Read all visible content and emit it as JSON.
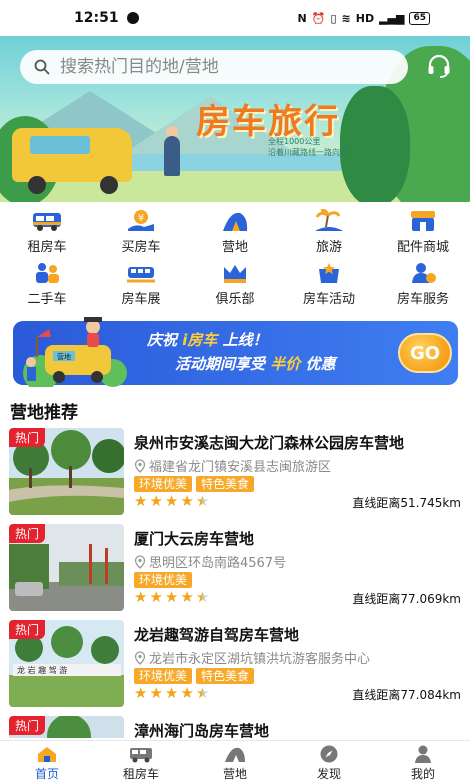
{
  "status_bar": {
    "time": "12:51",
    "battery": "65"
  },
  "hero": {
    "title": "房车旅行",
    "subtitle_1": "全程1000公里",
    "subtitle_2": "沿着川藏路线一路向西"
  },
  "search": {
    "placeholder": "搜索热门目的地/营地"
  },
  "categories": [
    {
      "label": "租房车",
      "icon": "rv-rental-icon"
    },
    {
      "label": "买房车",
      "icon": "buy-rv-icon"
    },
    {
      "label": "营地",
      "icon": "campsite-icon"
    },
    {
      "label": "旅游",
      "icon": "travel-icon"
    },
    {
      "label": "配件商城",
      "icon": "parts-shop-icon"
    },
    {
      "label": "二手车",
      "icon": "used-car-icon"
    },
    {
      "label": "房车展",
      "icon": "rv-expo-icon"
    },
    {
      "label": "俱乐部",
      "icon": "club-icon"
    },
    {
      "label": "房车活动",
      "icon": "rv-events-icon"
    },
    {
      "label": "房车服务",
      "icon": "rv-service-icon"
    }
  ],
  "promo": {
    "line1_prefix": "庆祝",
    "line1_highlight": "i房车",
    "line1_suffix": "上线！",
    "line2_prefix": "活动期间享受",
    "line2_highlight": "半价",
    "line2_suffix": "优惠",
    "go_label": "GO",
    "sign_text": "营地"
  },
  "section_title": "营地推荐",
  "camps": [
    {
      "hot": "热门",
      "name": "泉州市安溪志闽大龙门森林公园房车营地",
      "address": "福建省龙门镇安溪县志闽旅游区",
      "tags": [
        "环境优美",
        "特色美食"
      ],
      "rating": 4.5,
      "distance": "直线距离51.745km"
    },
    {
      "hot": "热门",
      "name": "厦门大云房车营地",
      "address": "思明区环岛南路4567号",
      "tags": [
        "环境优美"
      ],
      "rating": 4.5,
      "distance": "直线距离77.069km"
    },
    {
      "hot": "热门",
      "name": "龙岩趣驾游自驾房车营地",
      "address": "龙岩市永定区湖坑镇洪坑游客服务中心",
      "tags": [
        "环境优美",
        "特色美食"
      ],
      "rating": 4.5,
      "distance": "直线距离77.084km"
    },
    {
      "hot": "热门",
      "name": "漳州海门岛房车营地",
      "address": "",
      "tags": [],
      "rating": 0,
      "distance": ""
    }
  ],
  "nav": [
    {
      "label": "首页",
      "icon": "home-icon",
      "active": true
    },
    {
      "label": "租房车",
      "icon": "rv-icon",
      "active": false
    },
    {
      "label": "营地",
      "icon": "tent-icon",
      "active": false
    },
    {
      "label": "发现",
      "icon": "compass-icon",
      "active": false
    },
    {
      "label": "我的",
      "icon": "profile-icon",
      "active": false
    }
  ],
  "colors": {
    "accent": "#1e5fd6",
    "hot": "#e3232f",
    "tag": "#f7a829",
    "star": "#f4a21d",
    "promo": "#2b5ad9"
  }
}
